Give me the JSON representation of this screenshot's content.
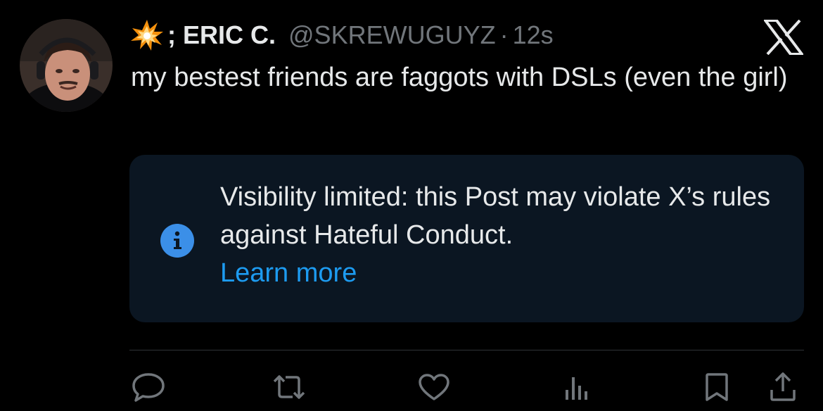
{
  "app": {
    "brand_icon": "x-logo-icon",
    "accent_color": "#1d9bf0",
    "background_color": "#000000",
    "secondary_text_color": "#71767b"
  },
  "post": {
    "author": {
      "emoji_icon": "collision-emoji-icon",
      "name": "; ERIC C.",
      "handle": "@SKREWUGUYZ",
      "separator": "·",
      "time": "12s"
    },
    "text": "my bestest friends are faggots with DSLs (even the girl)"
  },
  "notice": {
    "icon": "info-icon",
    "message": "Visibility limited: this Post may violate X’s rules against Hateful Conduct.",
    "link_label": "Learn more",
    "background_color": "#0b1622"
  },
  "actions": [
    {
      "name": "reply",
      "icon": "reply-icon"
    },
    {
      "name": "repost",
      "icon": "repost-icon"
    },
    {
      "name": "like",
      "icon": "like-icon"
    },
    {
      "name": "views",
      "icon": "views-icon"
    },
    {
      "name": "bookmark",
      "icon": "bookmark-icon"
    },
    {
      "name": "share",
      "icon": "share-icon"
    }
  ]
}
